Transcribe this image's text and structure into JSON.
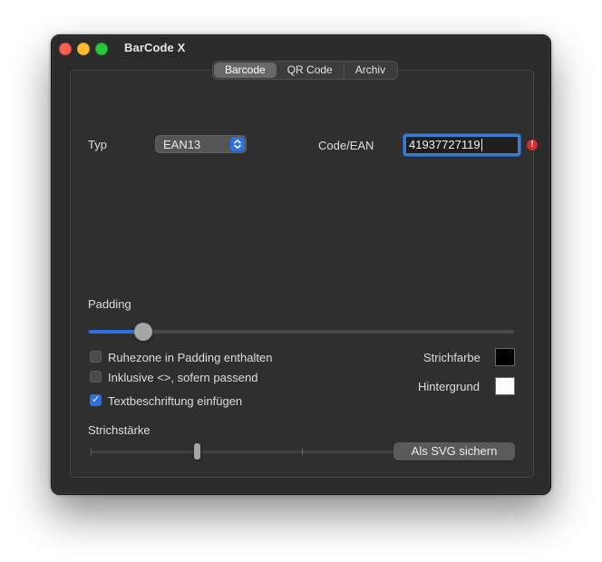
{
  "window": {
    "title": "BarCode X"
  },
  "tabs": [
    {
      "label": "Barcode",
      "selected": true
    },
    {
      "label": "QR Code",
      "selected": false
    },
    {
      "label": "Archiv",
      "selected": false
    }
  ],
  "form": {
    "type_label": "Typ",
    "type_value": "EAN13",
    "code_label": "Code/EAN",
    "code_value": "41937727119",
    "code_warning_icon": "exclamation-icon"
  },
  "padding": {
    "label": "Padding",
    "value_fraction": 0.12
  },
  "options": {
    "quiet_zone": {
      "label": "Ruhezone in Padding enthalten",
      "checked": false
    },
    "inclusive_brackets": {
      "label": "Inklusive <>, sofern passend",
      "checked": false
    },
    "text_label": {
      "label": "Textbeschriftung einfügen",
      "checked": true
    }
  },
  "colors": {
    "stroke_label": "Strichfarbe",
    "stroke_color": "#000000",
    "background_label": "Hintergrund",
    "background_color": "#ffffff",
    "accent": "#2f6fe4"
  },
  "stroke_width": {
    "label": "Strichstärke",
    "tick_count": 5,
    "value_fraction": 0.25
  },
  "actions": {
    "save_svg_label": "Als SVG sichern"
  }
}
